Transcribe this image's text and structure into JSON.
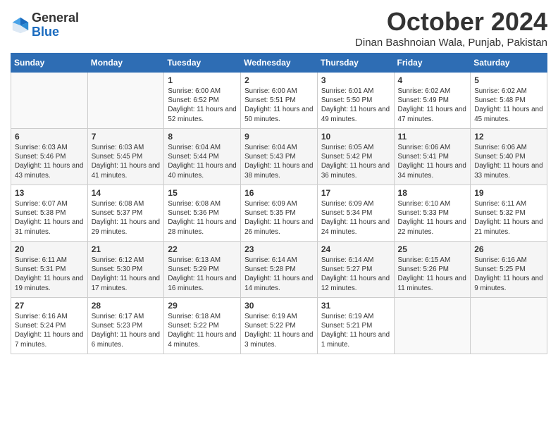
{
  "header": {
    "logo_general": "General",
    "logo_blue": "Blue",
    "month_title": "October 2024",
    "subtitle": "Dinan Bashnoian Wala, Punjab, Pakistan"
  },
  "weekdays": [
    "Sunday",
    "Monday",
    "Tuesday",
    "Wednesday",
    "Thursday",
    "Friday",
    "Saturday"
  ],
  "weeks": [
    [
      {
        "day": "",
        "sunrise": "",
        "sunset": "",
        "daylight": ""
      },
      {
        "day": "",
        "sunrise": "",
        "sunset": "",
        "daylight": ""
      },
      {
        "day": "1",
        "sunrise": "Sunrise: 6:00 AM",
        "sunset": "Sunset: 6:52 PM",
        "daylight": "Daylight: 11 hours and 52 minutes."
      },
      {
        "day": "2",
        "sunrise": "Sunrise: 6:00 AM",
        "sunset": "Sunset: 5:51 PM",
        "daylight": "Daylight: 11 hours and 50 minutes."
      },
      {
        "day": "3",
        "sunrise": "Sunrise: 6:01 AM",
        "sunset": "Sunset: 5:50 PM",
        "daylight": "Daylight: 11 hours and 49 minutes."
      },
      {
        "day": "4",
        "sunrise": "Sunrise: 6:02 AM",
        "sunset": "Sunset: 5:49 PM",
        "daylight": "Daylight: 11 hours and 47 minutes."
      },
      {
        "day": "5",
        "sunrise": "Sunrise: 6:02 AM",
        "sunset": "Sunset: 5:48 PM",
        "daylight": "Daylight: 11 hours and 45 minutes."
      }
    ],
    [
      {
        "day": "6",
        "sunrise": "Sunrise: 6:03 AM",
        "sunset": "Sunset: 5:46 PM",
        "daylight": "Daylight: 11 hours and 43 minutes."
      },
      {
        "day": "7",
        "sunrise": "Sunrise: 6:03 AM",
        "sunset": "Sunset: 5:45 PM",
        "daylight": "Daylight: 11 hours and 41 minutes."
      },
      {
        "day": "8",
        "sunrise": "Sunrise: 6:04 AM",
        "sunset": "Sunset: 5:44 PM",
        "daylight": "Daylight: 11 hours and 40 minutes."
      },
      {
        "day": "9",
        "sunrise": "Sunrise: 6:04 AM",
        "sunset": "Sunset: 5:43 PM",
        "daylight": "Daylight: 11 hours and 38 minutes."
      },
      {
        "day": "10",
        "sunrise": "Sunrise: 6:05 AM",
        "sunset": "Sunset: 5:42 PM",
        "daylight": "Daylight: 11 hours and 36 minutes."
      },
      {
        "day": "11",
        "sunrise": "Sunrise: 6:06 AM",
        "sunset": "Sunset: 5:41 PM",
        "daylight": "Daylight: 11 hours and 34 minutes."
      },
      {
        "day": "12",
        "sunrise": "Sunrise: 6:06 AM",
        "sunset": "Sunset: 5:40 PM",
        "daylight": "Daylight: 11 hours and 33 minutes."
      }
    ],
    [
      {
        "day": "13",
        "sunrise": "Sunrise: 6:07 AM",
        "sunset": "Sunset: 5:38 PM",
        "daylight": "Daylight: 11 hours and 31 minutes."
      },
      {
        "day": "14",
        "sunrise": "Sunrise: 6:08 AM",
        "sunset": "Sunset: 5:37 PM",
        "daylight": "Daylight: 11 hours and 29 minutes."
      },
      {
        "day": "15",
        "sunrise": "Sunrise: 6:08 AM",
        "sunset": "Sunset: 5:36 PM",
        "daylight": "Daylight: 11 hours and 28 minutes."
      },
      {
        "day": "16",
        "sunrise": "Sunrise: 6:09 AM",
        "sunset": "Sunset: 5:35 PM",
        "daylight": "Daylight: 11 hours and 26 minutes."
      },
      {
        "day": "17",
        "sunrise": "Sunrise: 6:09 AM",
        "sunset": "Sunset: 5:34 PM",
        "daylight": "Daylight: 11 hours and 24 minutes."
      },
      {
        "day": "18",
        "sunrise": "Sunrise: 6:10 AM",
        "sunset": "Sunset: 5:33 PM",
        "daylight": "Daylight: 11 hours and 22 minutes."
      },
      {
        "day": "19",
        "sunrise": "Sunrise: 6:11 AM",
        "sunset": "Sunset: 5:32 PM",
        "daylight": "Daylight: 11 hours and 21 minutes."
      }
    ],
    [
      {
        "day": "20",
        "sunrise": "Sunrise: 6:11 AM",
        "sunset": "Sunset: 5:31 PM",
        "daylight": "Daylight: 11 hours and 19 minutes."
      },
      {
        "day": "21",
        "sunrise": "Sunrise: 6:12 AM",
        "sunset": "Sunset: 5:30 PM",
        "daylight": "Daylight: 11 hours and 17 minutes."
      },
      {
        "day": "22",
        "sunrise": "Sunrise: 6:13 AM",
        "sunset": "Sunset: 5:29 PM",
        "daylight": "Daylight: 11 hours and 16 minutes."
      },
      {
        "day": "23",
        "sunrise": "Sunrise: 6:14 AM",
        "sunset": "Sunset: 5:28 PM",
        "daylight": "Daylight: 11 hours and 14 minutes."
      },
      {
        "day": "24",
        "sunrise": "Sunrise: 6:14 AM",
        "sunset": "Sunset: 5:27 PM",
        "daylight": "Daylight: 11 hours and 12 minutes."
      },
      {
        "day": "25",
        "sunrise": "Sunrise: 6:15 AM",
        "sunset": "Sunset: 5:26 PM",
        "daylight": "Daylight: 11 hours and 11 minutes."
      },
      {
        "day": "26",
        "sunrise": "Sunrise: 6:16 AM",
        "sunset": "Sunset: 5:25 PM",
        "daylight": "Daylight: 11 hours and 9 minutes."
      }
    ],
    [
      {
        "day": "27",
        "sunrise": "Sunrise: 6:16 AM",
        "sunset": "Sunset: 5:24 PM",
        "daylight": "Daylight: 11 hours and 7 minutes."
      },
      {
        "day": "28",
        "sunrise": "Sunrise: 6:17 AM",
        "sunset": "Sunset: 5:23 PM",
        "daylight": "Daylight: 11 hours and 6 minutes."
      },
      {
        "day": "29",
        "sunrise": "Sunrise: 6:18 AM",
        "sunset": "Sunset: 5:22 PM",
        "daylight": "Daylight: 11 hours and 4 minutes."
      },
      {
        "day": "30",
        "sunrise": "Sunrise: 6:19 AM",
        "sunset": "Sunset: 5:22 PM",
        "daylight": "Daylight: 11 hours and 3 minutes."
      },
      {
        "day": "31",
        "sunrise": "Sunrise: 6:19 AM",
        "sunset": "Sunset: 5:21 PM",
        "daylight": "Daylight: 11 hours and 1 minute."
      },
      {
        "day": "",
        "sunrise": "",
        "sunset": "",
        "daylight": ""
      },
      {
        "day": "",
        "sunrise": "",
        "sunset": "",
        "daylight": ""
      }
    ]
  ]
}
